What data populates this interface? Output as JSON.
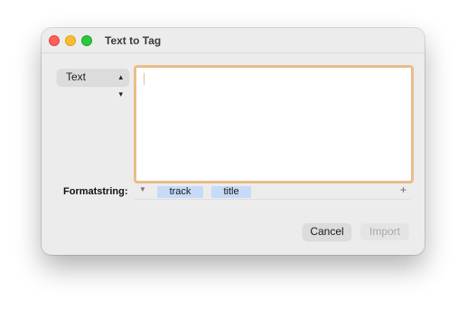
{
  "window": {
    "title": "Text to Tag"
  },
  "source_popup": {
    "selected": "Text",
    "icon": "chevron-up-down-icon"
  },
  "text_input": {
    "value": "",
    "focus_color": "#eabd8b"
  },
  "format": {
    "label": "Formatstring:",
    "tokens": [
      "track",
      "title"
    ],
    "token_color": "#c6dbf7",
    "add_icon": "plus-icon",
    "menu_icon": "triangle-down-icon"
  },
  "buttons": {
    "cancel": "Cancel",
    "import": "Import"
  }
}
